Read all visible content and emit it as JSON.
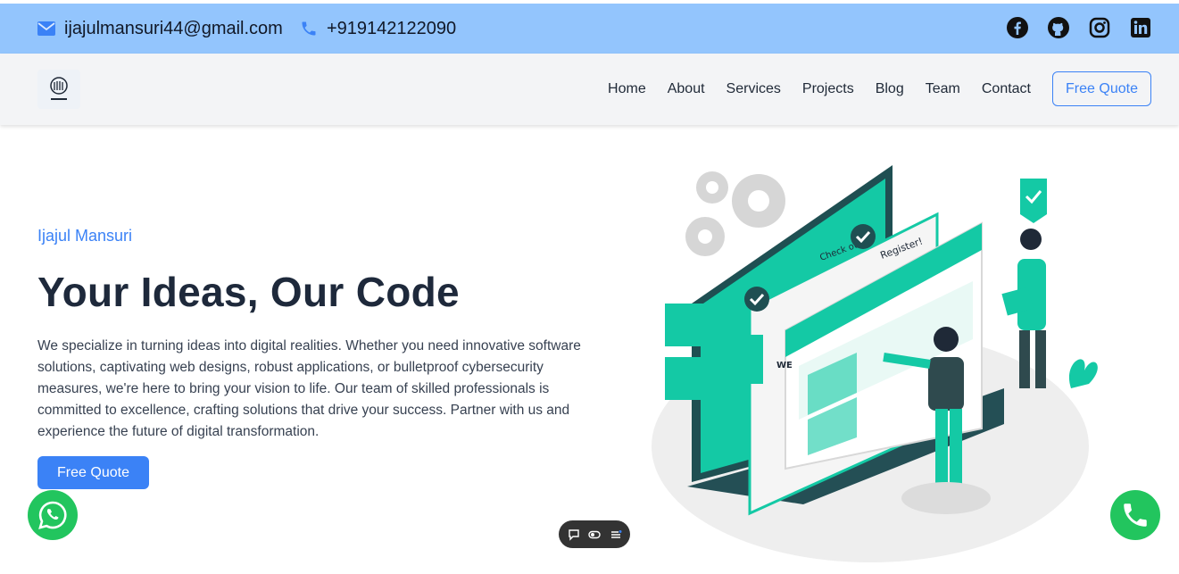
{
  "topbar": {
    "email": "ijajulmansuri44@gmail.com",
    "phone": "+919142122090",
    "socials": [
      "facebook-icon",
      "github-icon",
      "instagram-icon",
      "linkedin-icon"
    ]
  },
  "navbar": {
    "items": [
      "Home",
      "About",
      "Services",
      "Projects",
      "Blog",
      "Team",
      "Contact"
    ],
    "cta": "Free Quote"
  },
  "hero": {
    "eyebrow": "Ijajul Mansuri",
    "title": "Your Ideas, Our Code",
    "text": "We specialize in turning ideas into digital realities. Whether you need innovative software solutions, captivating web designs, robust applications, or bulletproof cybersecurity measures, we're here to bring your vision to life. Our team of skilled professionals is committed to excellence, crafting solutions that drive your success. Partner with us and experience the future of digital transformation.",
    "cta": "Free Quote",
    "illustration_labels": {
      "register": "Register!",
      "checkout": "Check out",
      "welcome": "WE"
    }
  },
  "colors": {
    "accent": "#3b82f6",
    "topbar": "#93c5fd",
    "teal": "#14c9a5",
    "whatsapp": "#22c55e"
  }
}
